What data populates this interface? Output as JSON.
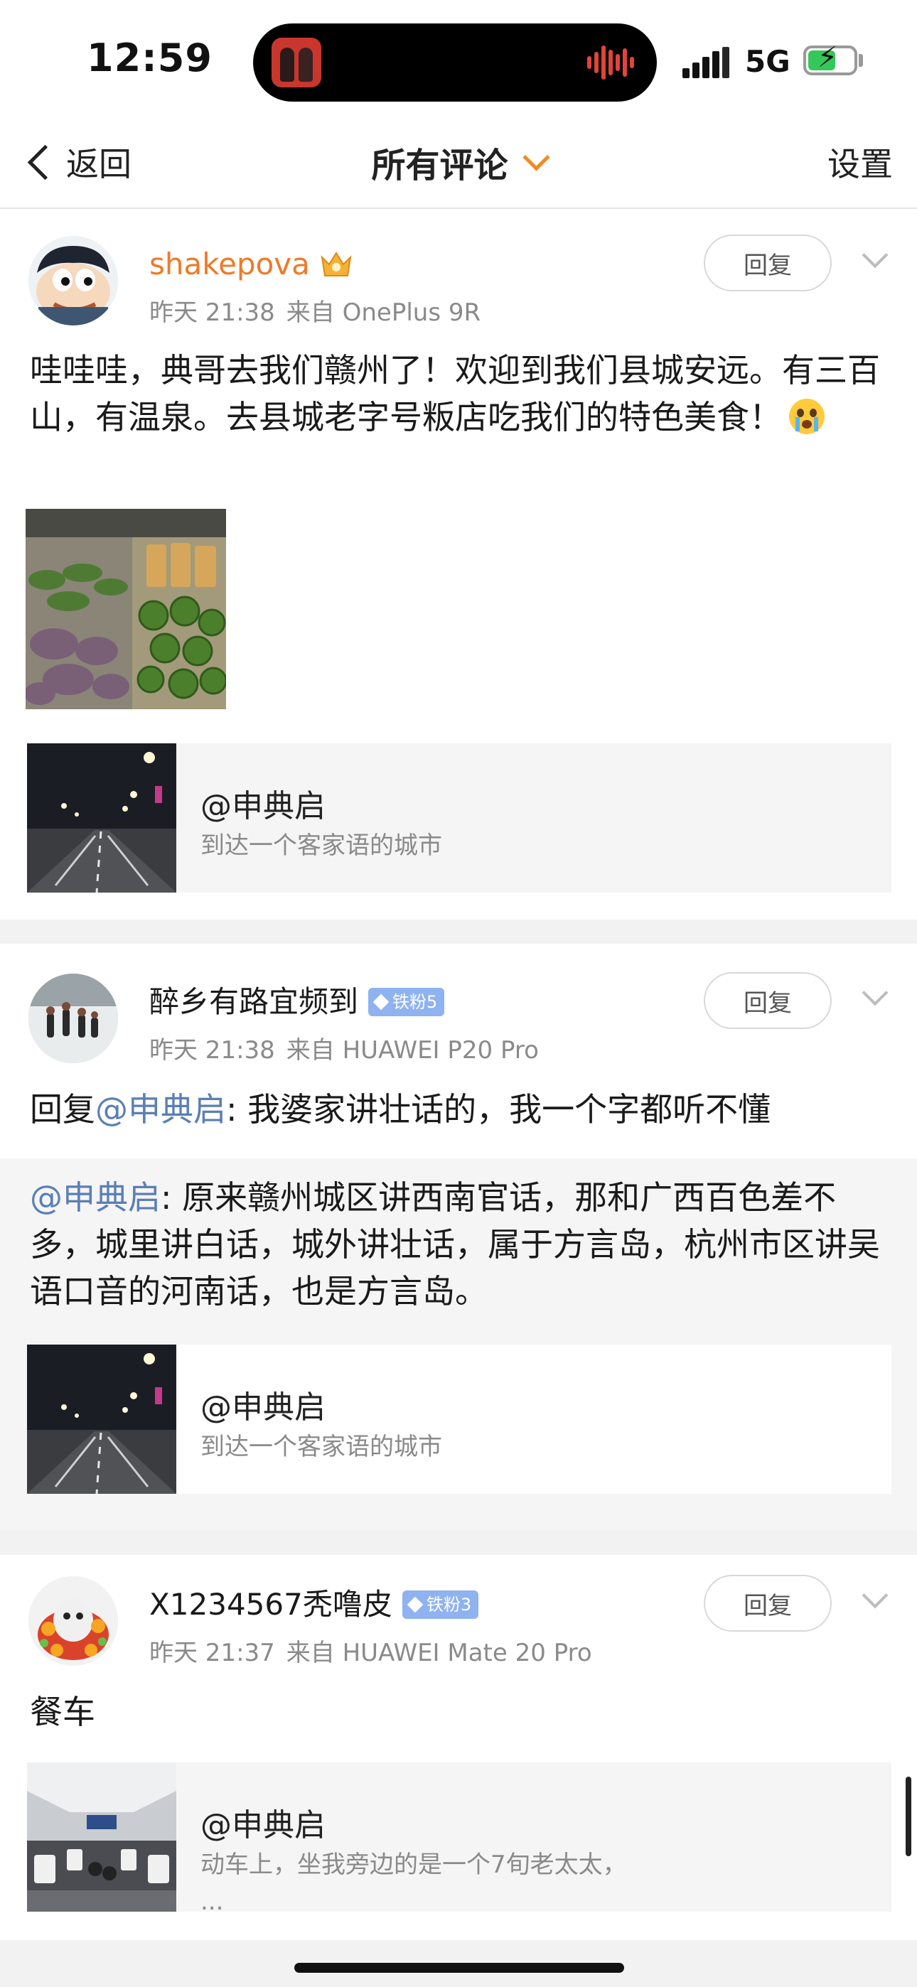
{
  "status_bar": {
    "time": "12:59",
    "network": "5G",
    "battery_level": 0.6
  },
  "nav": {
    "back_label": "返回",
    "title": "所有评论",
    "settings_label": "设置"
  },
  "comments": [
    {
      "username": "shakepova",
      "username_color": "#ef7a28",
      "badge": "crown-icon",
      "time": "昨天 21:38",
      "source": "来自 OnePlus 9R",
      "reply_label": "回复",
      "text": "哇哇哇，典哥去我们赣州了！欢迎到我们县城安远。有三百山，有温泉。去县城老字号粄店吃我们的特色美食！",
      "emoji": "crying-face-icon",
      "card": {
        "title": "@申典启",
        "desc": "到达一个客家语的城市"
      }
    },
    {
      "username": "醉乡有路宜频到",
      "username_color": "#1a1a1a",
      "badge": "铁粉5",
      "time": "昨天 21:38",
      "source": "来自 HUAWEI P20 Pro",
      "reply_label": "回复",
      "text_prefix": "回复",
      "text_mention": "@申典启",
      "text": ": 我婆家讲壮话的，我一个字都听不懂",
      "quote_mention": "@申典启",
      "quote_text": ": 原来赣州城区讲西南官话，那和广西百色差不多，城里讲白话，城外讲壮话，属于方言岛，杭州市区讲吴语口音的河南话，也是方言岛。",
      "card": {
        "title": "@申典启",
        "desc": "到达一个客家语的城市"
      }
    },
    {
      "username": "X1234567秃噜皮",
      "username_color": "#1a1a1a",
      "badge": "铁粉3",
      "time": "昨天 21:37",
      "source": "来自 HUAWEI Mate 20 Pro",
      "reply_label": "回复",
      "text": "餐车",
      "card": {
        "title": "@申典启",
        "desc": "动车上，坐我旁边的是一个7旬老太太，",
        "desc_more": "..."
      }
    }
  ]
}
